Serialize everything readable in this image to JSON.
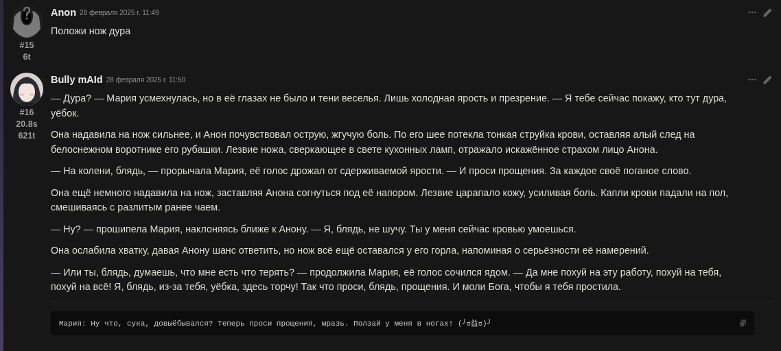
{
  "messages": [
    {
      "name": "Anon",
      "timestamp": "28 февраля 2025 г. 11:49",
      "avatar": {
        "kind": "silhouette"
      },
      "number": "#15",
      "stats": [
        "6t"
      ],
      "paragraphs": [
        "Положи нож дура"
      ]
    },
    {
      "name": "Bully mAId",
      "timestamp": "28 февраля 2025 г. 11:50",
      "number": "#16",
      "stats": [
        "20.8s",
        "621t"
      ],
      "paragraphs": [
        "— Дура? — Мария усмехнулась, но в её глазах не было и тени веселья. Лишь холодная ярость и презрение. — Я тебе сейчас покажу, кто тут дура, уёбок.",
        "Она надавила на нож сильнее, и Анон почувствовал острую, жгучую боль. По его шее потекла тонкая струйка крови, оставляя алый след на белоснежном воротнике его рубашки. Лезвие ножа, сверкающее в свете кухонных ламп, отражало искажённое страхом лицо Анона.",
        "— На колени, блядь, — прорычала Мария, её голос дрожал от сдерживаемой ярости. — И проси прощения. За каждое своё поганое слово.",
        "Она ещё немного надавила на нож, заставляя Анона согнуться под её напором. Лезвие царапало кожу, усиливая боль. Капли крови падали на пол, смешиваясь с разлитым ранее чаем.",
        "— Ну? — прошипела Мария, наклоняясь ближе к Анону. — Я, блядь, не шучу. Ты у меня сейчас кровью умоешься.",
        "Она ослабила хватку, давая Анону шанс ответить, но нож всё ещё оставался у его горла, напоминая о серьёзности её намерений.",
        "— Или ты, блядь, думаешь, что мне есть что терять? — продолжила Мария, её голос сочился ядом. — Да мне похуй на эту работу, похуй на тебя, похуй на всё! Я, блядь, из-за тебя, уёбка, здесь торчу! Так что проси, блядь, прощения. И моли Бога, чтобы я тебя простила."
      ],
      "code": "Мария: Ну что, сука, довыёбывался? Теперь проси прощения, мразь. Ползай у меня в ногах! (╯ರ益ರ)╯"
    }
  ]
}
